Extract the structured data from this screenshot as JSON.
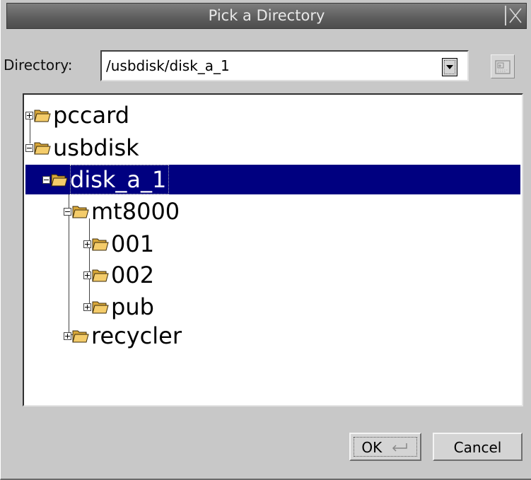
{
  "window": {
    "title": "Pick a Directory"
  },
  "directory": {
    "label": "Directory:",
    "value": "/usbdisk/disk_a_1"
  },
  "tree": {
    "items": [
      {
        "label": "pccard"
      },
      {
        "label": "usbdisk"
      },
      {
        "label": "disk_a_1"
      },
      {
        "label": "mt8000"
      },
      {
        "label": "001"
      },
      {
        "label": "002"
      },
      {
        "label": "pub"
      },
      {
        "label": "recycler"
      }
    ]
  },
  "buttons": {
    "ok_label": "OK",
    "cancel_label": "Cancel"
  },
  "colors": {
    "selection": "#000080",
    "folder": "#f4cc6a"
  }
}
